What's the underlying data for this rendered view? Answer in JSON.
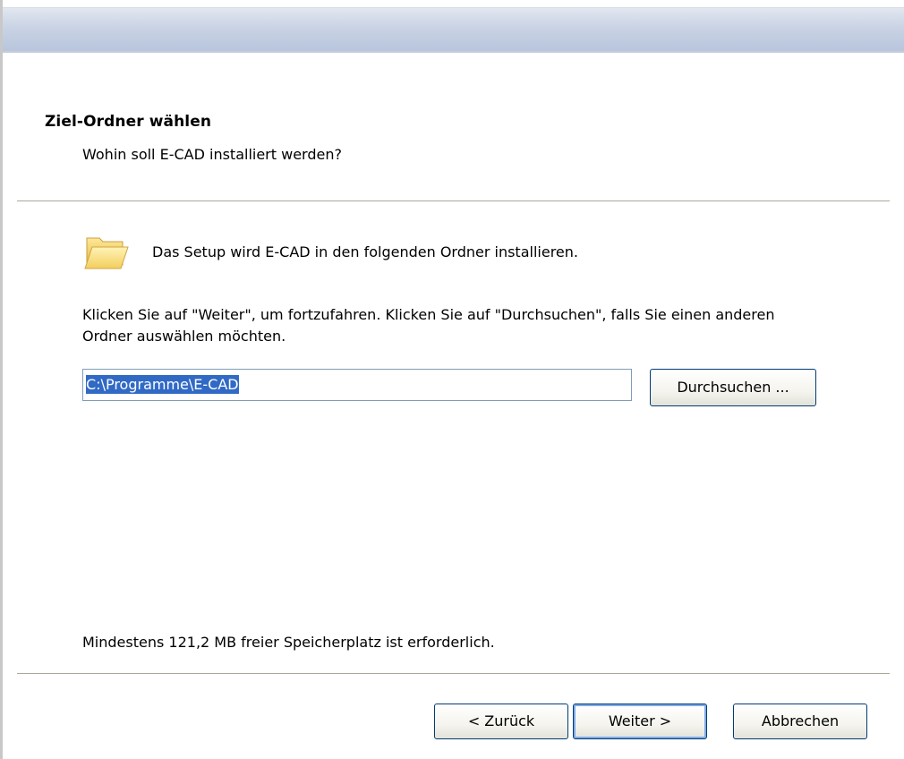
{
  "header": {
    "title": "Ziel-Ordner wählen",
    "subtitle": "Wohin soll E-CAD installiert werden?"
  },
  "main": {
    "folder_icon": "folder-icon",
    "info_text": "Das Setup wird E-CAD in den folgenden Ordner installieren.",
    "instructions": "Klicken Sie auf \"Weiter\", um fortzufahren. Klicken Sie auf \"Durchsuchen\", falls Sie einen anderen Ordner auswählen möchten.",
    "path_value": "C:\\Programme\\E-CAD",
    "browse_label": "Durchsuchen ...",
    "space_required": "Mindestens 121,2 MB freier Speicherplatz ist erforderlich."
  },
  "footer": {
    "back_label": "< Zurück",
    "next_label": "Weiter >",
    "cancel_label": "Abbrechen"
  },
  "colors": {
    "selection": "#316ac5",
    "button_border": "#003c74",
    "titlebar": "#c9d3e4"
  }
}
